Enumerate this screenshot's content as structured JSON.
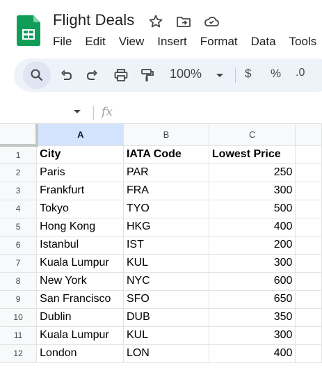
{
  "window": {
    "doc_title": "Flight Deals",
    "menu": [
      "File",
      "Edit",
      "View",
      "Insert",
      "Format",
      "Data",
      "Tools"
    ]
  },
  "toolbar": {
    "zoom": "100%",
    "currency": "$",
    "percent": "%",
    "decimal": ".0"
  },
  "formula_bar": {
    "fx": "fx",
    "value": ""
  },
  "sheet": {
    "columns": [
      "A",
      "B",
      "C",
      ""
    ],
    "selected_column": "A",
    "rows": [
      {
        "n": "1",
        "cells": [
          "City",
          "IATA Code",
          "Lowest Price"
        ]
      },
      {
        "n": "2",
        "cells": [
          "Paris",
          "PAR",
          "250"
        ]
      },
      {
        "n": "3",
        "cells": [
          "Frankfurt",
          "FRA",
          "300"
        ]
      },
      {
        "n": "4",
        "cells": [
          "Tokyo",
          "TYO",
          "500"
        ]
      },
      {
        "n": "5",
        "cells": [
          "Hong Kong",
          "HKG",
          "400"
        ]
      },
      {
        "n": "6",
        "cells": [
          "Istanbul",
          "IST",
          "200"
        ]
      },
      {
        "n": "7",
        "cells": [
          "Kuala Lumpur",
          "KUL",
          "300"
        ]
      },
      {
        "n": "8",
        "cells": [
          "New York",
          "NYC",
          "600"
        ]
      },
      {
        "n": "9",
        "cells": [
          "San Francisco",
          "SFO",
          "650"
        ]
      },
      {
        "n": "10",
        "cells": [
          "Dublin",
          "DUB",
          "350"
        ]
      },
      {
        "n": "11",
        "cells": [
          "Kuala Lumpur",
          "KUL",
          "300"
        ]
      },
      {
        "n": "12",
        "cells": [
          "London",
          "LON",
          "400"
        ]
      }
    ]
  },
  "colors": {
    "brand_green": "#188038",
    "selected_header": "#d3e3fd",
    "toolbar_bg": "#eef2f9"
  }
}
